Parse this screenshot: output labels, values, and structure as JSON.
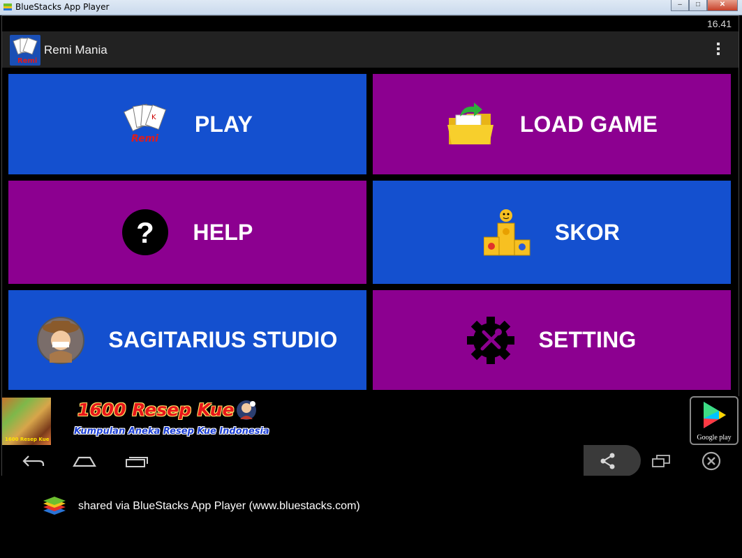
{
  "window": {
    "title": "BlueStacks App Player",
    "controls": {
      "minimize": "–",
      "maximize": "□",
      "close": "✕"
    }
  },
  "statusbar": {
    "time": "16.41"
  },
  "actionbar": {
    "app_title": "Remi Mania",
    "app_icon_text": "Remi"
  },
  "menu": {
    "play": {
      "label": "PLAY",
      "icon": "playing-cards-icon",
      "icon_text": "Remi"
    },
    "load_game": {
      "label": "LOAD GAME",
      "icon": "folder-icon"
    },
    "help": {
      "label": "HELP",
      "icon": "question-icon",
      "icon_text": "?"
    },
    "skor": {
      "label": "SKOR",
      "icon": "podium-icon"
    },
    "studio": {
      "label": "SAGITARIUS STUDIO",
      "icon": "studio-mascot-icon"
    },
    "setting": {
      "label": "SETTING",
      "icon": "gear-icon"
    }
  },
  "ad": {
    "thumb_text": "1600 Resep Kue",
    "title": "1600 Resep Kue",
    "subtitle": "Kumpulan Aneka Resep Kue Indonesia",
    "store_badge": "Google play"
  },
  "navbar": [
    "back-icon",
    "home-icon",
    "recents-icon",
    "share-icon",
    "window-resize-icon",
    "close-circle-icon"
  ],
  "footer": {
    "text": "shared via BlueStacks App Player (www.bluestacks.com)"
  },
  "colors": {
    "tile_blue": "#1450cf",
    "tile_purple": "#8c0090",
    "actionbar": "#222222"
  }
}
